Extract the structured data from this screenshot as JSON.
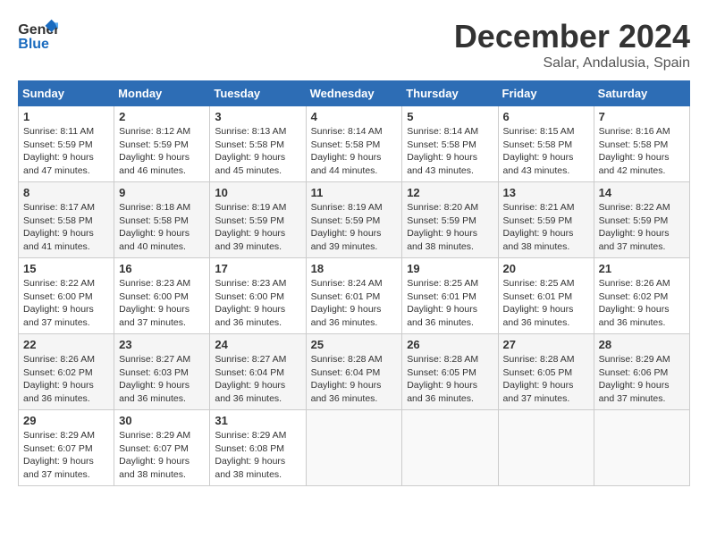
{
  "header": {
    "logo_general": "General",
    "logo_blue": "Blue",
    "month_title": "December 2024",
    "location": "Salar, Andalusia, Spain"
  },
  "calendar": {
    "days_of_week": [
      "Sunday",
      "Monday",
      "Tuesday",
      "Wednesday",
      "Thursday",
      "Friday",
      "Saturday"
    ],
    "weeks": [
      [
        null,
        null,
        null,
        null,
        null,
        null,
        null
      ]
    ],
    "cells": {
      "1": {
        "day": "1",
        "sunrise": "8:11 AM",
        "sunset": "5:59 PM",
        "daylight": "9 hours and 47 minutes."
      },
      "2": {
        "day": "2",
        "sunrise": "8:12 AM",
        "sunset": "5:59 PM",
        "daylight": "9 hours and 46 minutes."
      },
      "3": {
        "day": "3",
        "sunrise": "8:13 AM",
        "sunset": "5:58 PM",
        "daylight": "9 hours and 45 minutes."
      },
      "4": {
        "day": "4",
        "sunrise": "8:14 AM",
        "sunset": "5:58 PM",
        "daylight": "9 hours and 44 minutes."
      },
      "5": {
        "day": "5",
        "sunrise": "8:14 AM",
        "sunset": "5:58 PM",
        "daylight": "9 hours and 43 minutes."
      },
      "6": {
        "day": "6",
        "sunrise": "8:15 AM",
        "sunset": "5:58 PM",
        "daylight": "9 hours and 43 minutes."
      },
      "7": {
        "day": "7",
        "sunrise": "8:16 AM",
        "sunset": "5:58 PM",
        "daylight": "9 hours and 42 minutes."
      },
      "8": {
        "day": "8",
        "sunrise": "8:17 AM",
        "sunset": "5:58 PM",
        "daylight": "9 hours and 41 minutes."
      },
      "9": {
        "day": "9",
        "sunrise": "8:18 AM",
        "sunset": "5:58 PM",
        "daylight": "9 hours and 40 minutes."
      },
      "10": {
        "day": "10",
        "sunrise": "8:19 AM",
        "sunset": "5:59 PM",
        "daylight": "9 hours and 39 minutes."
      },
      "11": {
        "day": "11",
        "sunrise": "8:19 AM",
        "sunset": "5:59 PM",
        "daylight": "9 hours and 39 minutes."
      },
      "12": {
        "day": "12",
        "sunrise": "8:20 AM",
        "sunset": "5:59 PM",
        "daylight": "9 hours and 38 minutes."
      },
      "13": {
        "day": "13",
        "sunrise": "8:21 AM",
        "sunset": "5:59 PM",
        "daylight": "9 hours and 38 minutes."
      },
      "14": {
        "day": "14",
        "sunrise": "8:22 AM",
        "sunset": "5:59 PM",
        "daylight": "9 hours and 37 minutes."
      },
      "15": {
        "day": "15",
        "sunrise": "8:22 AM",
        "sunset": "6:00 PM",
        "daylight": "9 hours and 37 minutes."
      },
      "16": {
        "day": "16",
        "sunrise": "8:23 AM",
        "sunset": "6:00 PM",
        "daylight": "9 hours and 37 minutes."
      },
      "17": {
        "day": "17",
        "sunrise": "8:23 AM",
        "sunset": "6:00 PM",
        "daylight": "9 hours and 36 minutes."
      },
      "18": {
        "day": "18",
        "sunrise": "8:24 AM",
        "sunset": "6:01 PM",
        "daylight": "9 hours and 36 minutes."
      },
      "19": {
        "day": "19",
        "sunrise": "8:25 AM",
        "sunset": "6:01 PM",
        "daylight": "9 hours and 36 minutes."
      },
      "20": {
        "day": "20",
        "sunrise": "8:25 AM",
        "sunset": "6:01 PM",
        "daylight": "9 hours and 36 minutes."
      },
      "21": {
        "day": "21",
        "sunrise": "8:26 AM",
        "sunset": "6:02 PM",
        "daylight": "9 hours and 36 minutes."
      },
      "22": {
        "day": "22",
        "sunrise": "8:26 AM",
        "sunset": "6:02 PM",
        "daylight": "9 hours and 36 minutes."
      },
      "23": {
        "day": "23",
        "sunrise": "8:27 AM",
        "sunset": "6:03 PM",
        "daylight": "9 hours and 36 minutes."
      },
      "24": {
        "day": "24",
        "sunrise": "8:27 AM",
        "sunset": "6:04 PM",
        "daylight": "9 hours and 36 minutes."
      },
      "25": {
        "day": "25",
        "sunrise": "8:28 AM",
        "sunset": "6:04 PM",
        "daylight": "9 hours and 36 minutes."
      },
      "26": {
        "day": "26",
        "sunrise": "8:28 AM",
        "sunset": "6:05 PM",
        "daylight": "9 hours and 36 minutes."
      },
      "27": {
        "day": "27",
        "sunrise": "8:28 AM",
        "sunset": "6:05 PM",
        "daylight": "9 hours and 37 minutes."
      },
      "28": {
        "day": "28",
        "sunrise": "8:29 AM",
        "sunset": "6:06 PM",
        "daylight": "9 hours and 37 minutes."
      },
      "29": {
        "day": "29",
        "sunrise": "8:29 AM",
        "sunset": "6:07 PM",
        "daylight": "9 hours and 37 minutes."
      },
      "30": {
        "day": "30",
        "sunrise": "8:29 AM",
        "sunset": "6:07 PM",
        "daylight": "9 hours and 38 minutes."
      },
      "31": {
        "day": "31",
        "sunrise": "8:29 AM",
        "sunset": "6:08 PM",
        "daylight": "9 hours and 38 minutes."
      }
    },
    "labels": {
      "sunrise": "Sunrise:",
      "sunset": "Sunset:",
      "daylight": "Daylight:"
    }
  }
}
